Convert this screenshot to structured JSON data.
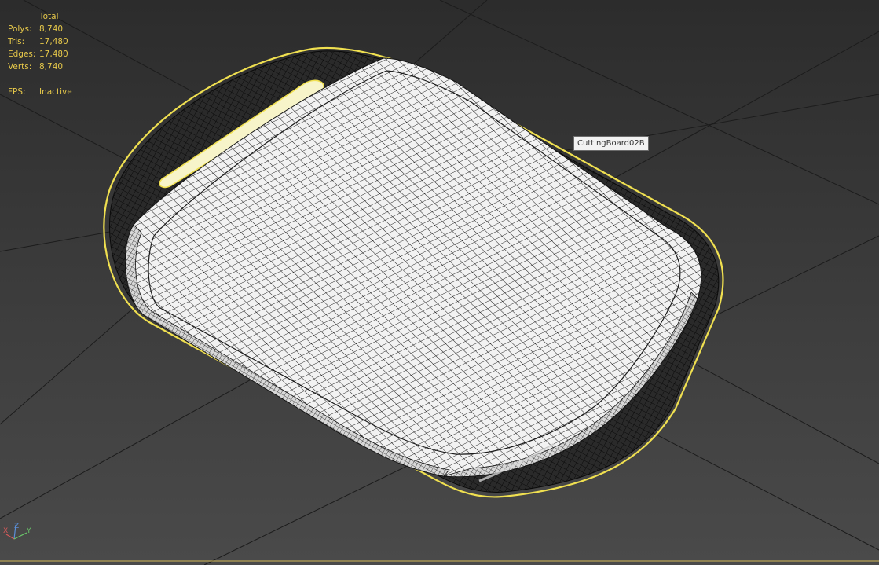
{
  "stats": {
    "header": "Total",
    "rows": [
      {
        "label": "Polys:",
        "value": "8,740"
      },
      {
        "label": "Tris:",
        "value": "17,480"
      },
      {
        "label": "Edges:",
        "value": "17,480"
      },
      {
        "label": "Verts:",
        "value": "8,740"
      }
    ],
    "fps_label": "FPS:",
    "fps_value": "Inactive"
  },
  "tooltip": {
    "object_name": "CuttingBoard02B"
  },
  "gizmo": {
    "x": "X",
    "y": "Y",
    "z": "Z"
  },
  "colors": {
    "stats_text": "#e6c84a",
    "selection_outline": "#f0e050",
    "viewport_bg": "#3a3a3a",
    "wire": "#111111",
    "surface": "#f2f2f2"
  }
}
